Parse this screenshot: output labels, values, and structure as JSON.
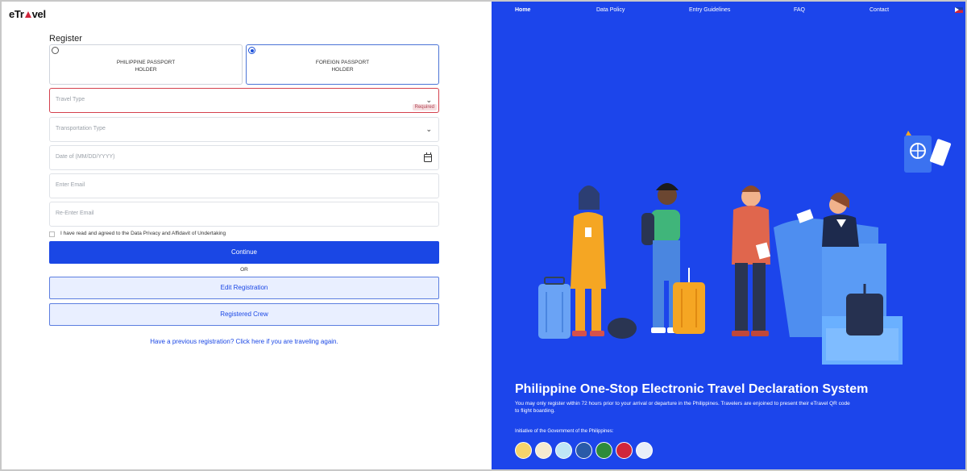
{
  "logo": {
    "prefix": "eTr",
    "suffix": "vel"
  },
  "register": {
    "title": "Register",
    "passport_options": [
      {
        "line1": "PHILIPPINE PASSPORT",
        "line2": "HOLDER",
        "selected": false
      },
      {
        "line1": "FOREIGN PASSPORT",
        "line2": "HOLDER",
        "selected": true
      }
    ],
    "travel_type": {
      "placeholder": "Travel Type",
      "error": "Required"
    },
    "transportation_type": {
      "placeholder": "Transportation Type"
    },
    "date": {
      "placeholder": "Date of (MM/DD/YYYY)"
    },
    "email": {
      "placeholder": "Enter Email"
    },
    "reenter_email": {
      "placeholder": "Re-Enter Email"
    },
    "agreement": "I have read and agreed to the Data Privacy and Affidavit of Undertaking",
    "continue_label": "Continue",
    "or_label": "OR",
    "edit_label": "Edit Registration",
    "crew_label": "Registered Crew",
    "previous_link": "Have a previous registration? Click here if you are traveling again."
  },
  "nav": {
    "items": [
      "Home",
      "Data Policy",
      "Entry Guidelines",
      "FAQ",
      "Contact"
    ],
    "active": "Home"
  },
  "hero": {
    "title": "Philippine One-Stop Electronic Travel Declaration System",
    "description": "You may only register within 72 hours prior to your arrival or departure in the Philippines. Travelers are enjoined to present their eTravel QR code to flight boarding.",
    "initiative": "Initiative of the Government of the Philippines:"
  },
  "colors": {
    "brand_blue": "#1a47e5",
    "panel_blue": "#1c45eb",
    "error_red": "#d4404d",
    "logo_red": "#d0263b"
  },
  "icons": [
    "radio-icon",
    "chevron-down-icon",
    "calendar-icon",
    "checkbox-icon",
    "flag-icon",
    "seal-icon"
  ]
}
